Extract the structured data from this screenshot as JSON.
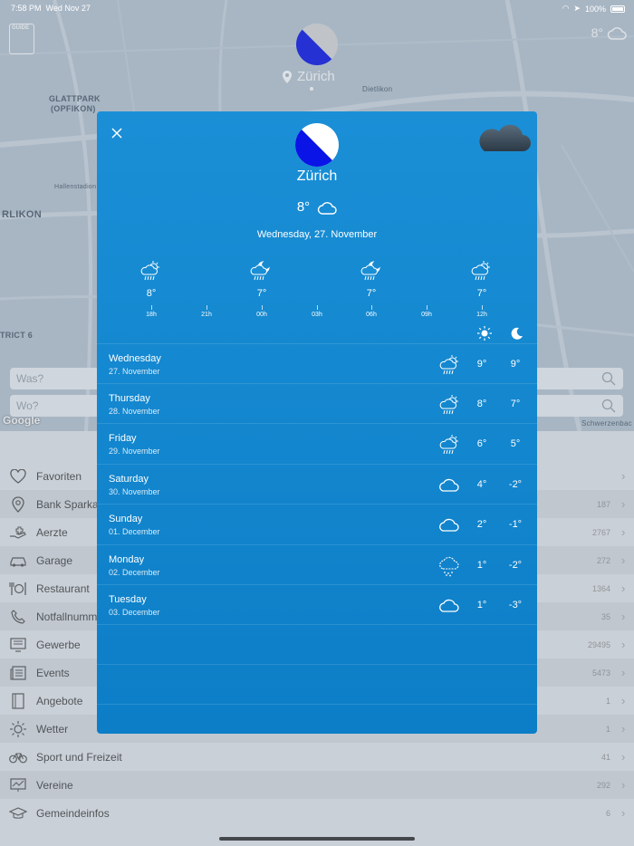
{
  "status": {
    "time": "7:58 PM",
    "date": "Wed Nov 27",
    "battery": "100%"
  },
  "map": {
    "labels": [
      "GLATTPARK",
      "(OPFIKON)",
      "Hallenstadion",
      "RLIKON",
      "Dietlikon",
      "TRICT 6",
      "Schwerzenbac"
    ],
    "google": "Google"
  },
  "header": {
    "city": "Zürich",
    "temp": "8°",
    "guide_label": "GUIDE"
  },
  "search": {
    "what_placeholder": "Was?",
    "where_placeholder": "Wo?"
  },
  "list": [
    {
      "label": "Favoriten",
      "count": "",
      "icon": "heart-icon"
    },
    {
      "label": "Bank Sparkas",
      "count": "187",
      "icon": "map-pin-icon"
    },
    {
      "label": "Aerzte",
      "count": "2767",
      "icon": "medical-hand-icon"
    },
    {
      "label": "Garage",
      "count": "272",
      "icon": "car-icon"
    },
    {
      "label": "Restaurant",
      "count": "1364",
      "icon": "cutlery-icon"
    },
    {
      "label": "Notfallnumme",
      "count": "35",
      "icon": "phone-icon"
    },
    {
      "label": "Gewerbe",
      "count": "29495",
      "icon": "monitor-icon"
    },
    {
      "label": "Events",
      "count": "5473",
      "icon": "newspaper-icon"
    },
    {
      "label": "Angebote",
      "count": "1",
      "icon": "book-icon"
    },
    {
      "label": "Wetter",
      "count": "1",
      "icon": "sun-icon"
    },
    {
      "label": "Sport und Freizeit",
      "count": "41",
      "icon": "bicycle-icon"
    },
    {
      "label": "Vereine",
      "count": "292",
      "icon": "chart-board-icon"
    },
    {
      "label": "Gemeindeinfos",
      "count": "6",
      "icon": "graduation-cap-icon"
    }
  ],
  "modal": {
    "city": "Zürich",
    "current_temp": "8°",
    "date": "Wednesday, 27. November",
    "hourly": [
      {
        "time": "18h",
        "temp": "8°",
        "icon": "sun-rain-icon"
      },
      {
        "time": "21h",
        "temp": "",
        "icon": ""
      },
      {
        "time": "00h",
        "temp": "7°",
        "icon": "moon-rain-icon"
      },
      {
        "time": "03h",
        "temp": "",
        "icon": ""
      },
      {
        "time": "06h",
        "temp": "7°",
        "icon": "moon-rain-icon"
      },
      {
        "time": "09h",
        "temp": "",
        "icon": ""
      },
      {
        "time": "12h",
        "temp": "7°",
        "icon": "sun-rain-icon"
      }
    ],
    "days": [
      {
        "name": "Wednesday",
        "date": "27. November",
        "hi": "9°",
        "lo": "9°",
        "icon": "sun-rain-icon"
      },
      {
        "name": "Thursday",
        "date": "28. November",
        "hi": "8°",
        "lo": "7°",
        "icon": "sun-rain-icon"
      },
      {
        "name": "Friday",
        "date": "29. November",
        "hi": "6°",
        "lo": "5°",
        "icon": "sun-rain-icon"
      },
      {
        "name": "Saturday",
        "date": "30. November",
        "hi": "4°",
        "lo": "-2°",
        "icon": "cloud-icon"
      },
      {
        "name": "Sunday",
        "date": "01. December",
        "hi": "2°",
        "lo": "-1°",
        "icon": "cloud-icon"
      },
      {
        "name": "Monday",
        "date": "02. December",
        "hi": "1°",
        "lo": "-2°",
        "icon": "snow-cloud-icon"
      },
      {
        "name": "Tuesday",
        "date": "03. December",
        "hi": "1°",
        "lo": "-3°",
        "icon": "cloud-icon"
      }
    ]
  },
  "colors": {
    "modal_blue": "#1a8fd6",
    "logo_blue": "#0a14e6",
    "logo_grey": "#d9d9d9"
  }
}
